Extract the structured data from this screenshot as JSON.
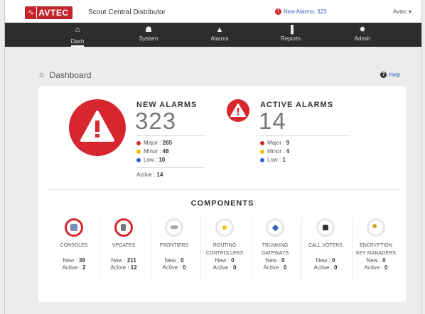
{
  "topbar": {
    "logo_text": "AVTEC",
    "distributor": "Scout Central Distributor",
    "new_alarms_link": "New Alarms: 323",
    "user_menu": "Avtec ▾"
  },
  "nav": [
    {
      "label": "Dash",
      "icon": "home-icon",
      "glyph": "⌂"
    },
    {
      "label": "System",
      "icon": "sitemap-icon",
      "glyph": "☗"
    },
    {
      "label": "Alarms",
      "icon": "warning-icon",
      "glyph": "▲"
    },
    {
      "label": "Reports",
      "icon": "bar-chart-icon",
      "glyph": "▐"
    },
    {
      "label": "Admin",
      "icon": "gear-icon",
      "glyph": "✹"
    }
  ],
  "page": {
    "title": "Dashboard",
    "help": "Help"
  },
  "new_alarms": {
    "title": "NEW ALARMS",
    "count": "323",
    "major_label": "Major : ",
    "major": "265",
    "minor_label": "Minor : ",
    "minor": "48",
    "low_label": "Low : ",
    "low": "10",
    "active_label": "Active : ",
    "active": "14"
  },
  "active_alarms": {
    "title": "ACTIVE ALARMS",
    "count": "14",
    "major_label": "Major : ",
    "major": "9",
    "minor_label": "Minor : ",
    "minor": "4",
    "low_label": "Low : ",
    "low": "1"
  },
  "colors": {
    "alarm_red": "#d7262e",
    "major": "#d7262e",
    "minor": "#f2c200",
    "low": "#2f62c8",
    "nav_bg": "#2d2d2d"
  },
  "components": {
    "title": "COMPONENTS",
    "new_label": "New : ",
    "active_label": "Active : ",
    "items": [
      {
        "name1": "CONSOLES",
        "name2": "",
        "new": "39",
        "active": "2",
        "icon": "console-icon",
        "alarm": true,
        "inner": "#7a8cb8"
      },
      {
        "name1": "VPGATES",
        "name2": "",
        "new": "211",
        "active": "12",
        "icon": "vpgate-icon",
        "alarm": true,
        "inner": "#777"
      },
      {
        "name1": "FRONTIERS",
        "name2": "",
        "new": "0",
        "active": "0",
        "icon": "frontier-icon",
        "alarm": false,
        "inner": "#aaa"
      },
      {
        "name1": "ROUTING",
        "name2": "CONTROLLERS",
        "new": "0",
        "active": "0",
        "icon": "routing-icon",
        "alarm": false,
        "inner": "#f2c200"
      },
      {
        "name1": "TRUNKING",
        "name2": "GATEWAYS",
        "new": "0",
        "active": "0",
        "icon": "trunking-icon",
        "alarm": false,
        "inner": "#3a62b8"
      },
      {
        "name1": "CALL VOTERS",
        "name2": "",
        "new": "0",
        "active": "0",
        "icon": "thumbs-up-icon",
        "alarm": false,
        "inner": "#333"
      },
      {
        "name1": "ENCRYPTION",
        "name2": "KEY MANAGERS",
        "new": "0",
        "active": "0",
        "icon": "key-icon",
        "alarm": false,
        "inner": "#e0a030"
      }
    ]
  }
}
